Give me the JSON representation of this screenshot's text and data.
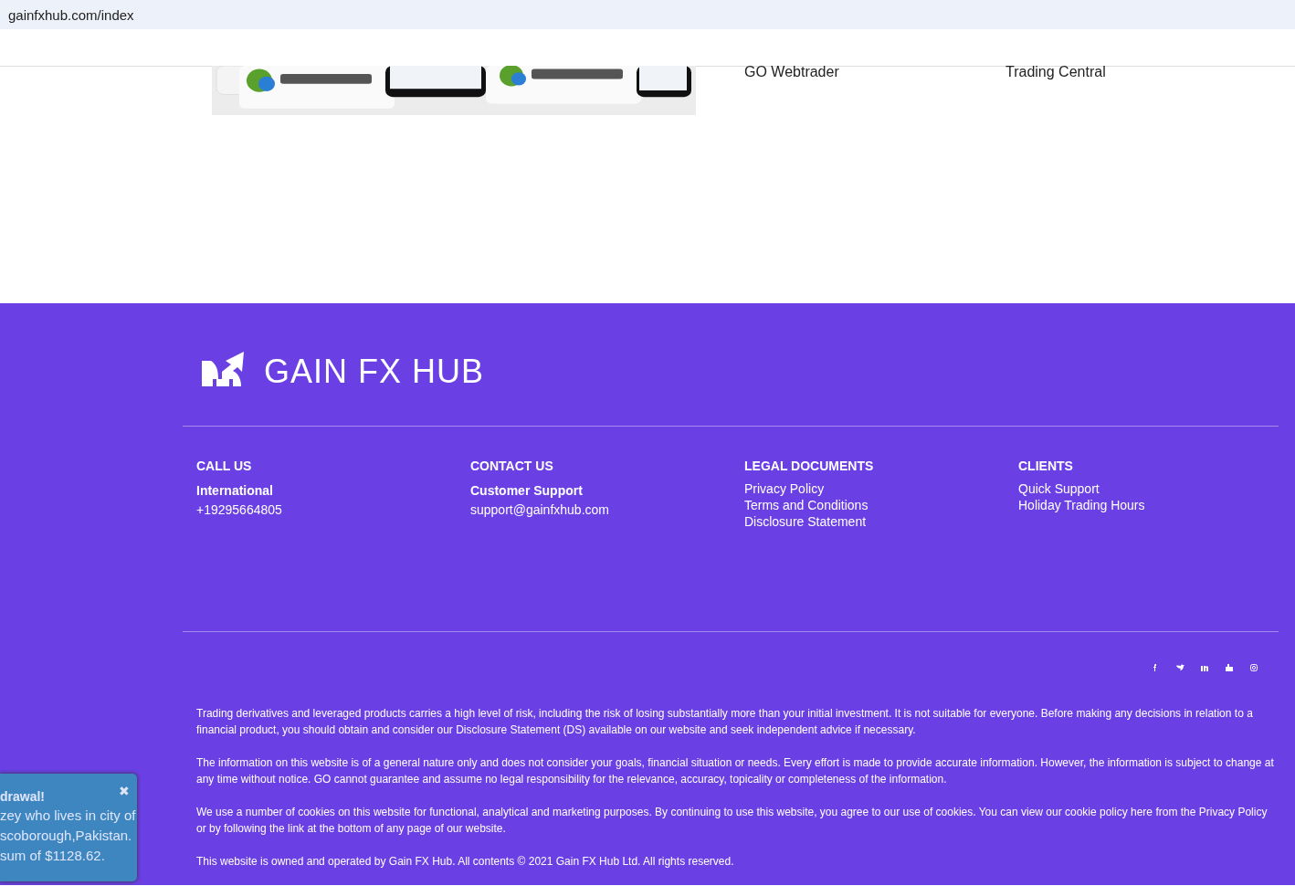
{
  "address_bar": {
    "url": "gainfxhub.com/index"
  },
  "platforms": [
    {
      "kind": "picture"
    },
    {
      "label": "GO Webtrader"
    },
    {
      "label": "Trading Central"
    }
  ],
  "footer": {
    "logo": "GAIN FX HUB",
    "columns": [
      {
        "heading": "CALL US",
        "subheading": "International",
        "lines": [
          "+19295664805"
        ]
      },
      {
        "heading": "CONTACT US",
        "subheading": "Customer Support",
        "lines": [
          "support@gainfxhub.com"
        ]
      },
      {
        "heading": "LEGAL DOCUMENTS",
        "lines": [
          "Privacy Policy",
          "Terms and Conditions",
          "Disclosure Statement"
        ]
      },
      {
        "heading": "CLIENTS",
        "lines": [
          "Quick Support",
          "Holiday Trading Hours"
        ]
      }
    ],
    "social": [
      {
        "kind": "facebook"
      },
      {
        "kind": "twitter"
      },
      {
        "kind": "linkedin"
      },
      {
        "kind": "youtube"
      },
      {
        "kind": "instagram"
      }
    ],
    "paragraphs": [
      "Trading derivatives and leveraged products carries a high level of risk, including the risk of losing substantially more than your initial investment. It is not suitable for everyone. Before making any decisions in relation to a financial product, you should obtain and consider our Disclosure Statement (DS) available on our website and seek independent advice if necessary.",
      "The information on this website is of a general nature only and does not consider your goals, financial situation or needs. Every effort is made to provide accurate information. However, the information is subject to change at any time without notice. GO cannot guarantee and assume no legal responsibility for the relevance, accuracy, topicality or completeness of the information.",
      "We use a number of cookies on this website for functional, analytical and marketing purposes. By continuing to use this website, you agree to our use of cookies. You can view our cookie policy here from the Privacy Policy or by following the link at the bottom of any page of our website.",
      "This website is owned and operated by Gain FX Hub. All contents © 2021 Gain FX Hub Ltd. All rights reserved."
    ]
  },
  "toast": {
    "close": "✖",
    "title": "drawal!",
    "lines": [
      "zey who lives in city of",
      "scoborough,Pakistan.",
      "sum of $1128.62."
    ]
  }
}
